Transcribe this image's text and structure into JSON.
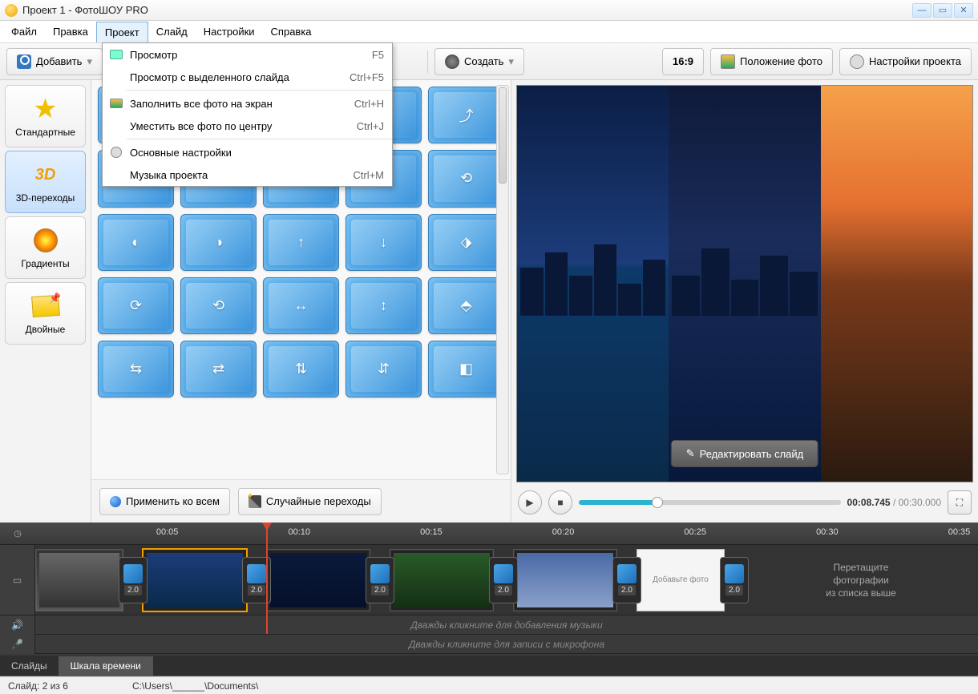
{
  "title": "Проект 1 - ФотоШОУ PRO",
  "menu": {
    "file": "Файл",
    "edit": "Правка",
    "project": "Проект",
    "slide": "Слайд",
    "settings": "Настройки",
    "help": "Справка"
  },
  "project_menu": [
    {
      "label": "Просмотр",
      "shortcut": "F5",
      "icon": "monitor"
    },
    {
      "label": "Просмотр с выделенного слайда",
      "shortcut": "Ctrl+F5",
      "icon": ""
    },
    {
      "sep": true
    },
    {
      "label": "Заполнить все фото на экран",
      "shortcut": "Ctrl+H",
      "icon": "photo"
    },
    {
      "label": "Уместить все фото по центру",
      "shortcut": "Ctrl+J",
      "icon": ""
    },
    {
      "sep": true
    },
    {
      "label": "Основные настройки",
      "shortcut": "",
      "icon": "gear"
    },
    {
      "label": "Музыка проекта",
      "shortcut": "Ctrl+M",
      "icon": ""
    }
  ],
  "toolbar": {
    "add": "Добавить",
    "create": "Создать",
    "aspect": "16:9",
    "photo_position": "Положение фото",
    "project_settings": "Настройки проекта"
  },
  "categories": [
    {
      "id": "standard",
      "label": "Стандартные",
      "icon": "star"
    },
    {
      "id": "3d",
      "label": "3D-переходы",
      "icon": "3d"
    },
    {
      "id": "gradients",
      "label": "Градиенты",
      "icon": "grad"
    },
    {
      "id": "double",
      "label": "Двойные",
      "icon": "double"
    }
  ],
  "active_category": "3d",
  "transitions_buttons": {
    "apply_all": "Применить ко всем",
    "random": "Случайные переходы"
  },
  "preview": {
    "edit_slide": "Редактировать слайд",
    "time_current": "00:08.745",
    "time_total": "00:30.000"
  },
  "timeline": {
    "ticks": [
      "00:05",
      "00:10",
      "00:15",
      "00:20",
      "00:25",
      "00:30",
      "00:35"
    ],
    "transitions_duration": "2.0",
    "placeholder_l1": "Перетащите",
    "placeholder_l2": "фотографии",
    "placeholder_l3": "из списка выше",
    "audio_hint": "Дважды кликните для добавления музыки",
    "mic_hint": "Дважды кликните для записи с микрофона",
    "add_photo": "Добавьте фото"
  },
  "bottom_tabs": {
    "slides": "Слайды",
    "timeline": "Шкала времени"
  },
  "status": {
    "slide": "Слайд: 2 из 6",
    "path": "C:\\Users\\______\\Documents\\"
  }
}
